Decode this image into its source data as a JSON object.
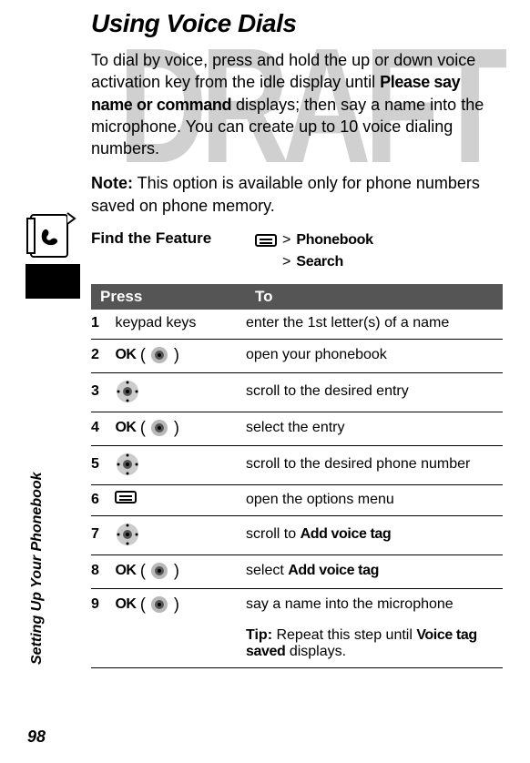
{
  "watermark": "DRAFT",
  "title": "Using Voice Dials",
  "intro": {
    "before": "To dial by voice, press and hold the up or down voice activation key from the idle display until ",
    "emph": "Please say name or command",
    "after": " displays; then say a name into the microphone. You can create up to 10 voice dialing numbers."
  },
  "note": {
    "label": "Note:",
    "text": " This option is available only for phone numbers saved on phone memory."
  },
  "feature": {
    "label": "Find the Feature",
    "nav1": "Phonebook",
    "nav2": "Search"
  },
  "table": {
    "h1": "Press",
    "h2": "To",
    "rows": [
      {
        "n": "1",
        "press_type": "text",
        "press": "keypad keys",
        "to": "enter the 1st letter(s) of a name"
      },
      {
        "n": "2",
        "press_type": "ok",
        "ok": "OK",
        "to": "open your phonebook"
      },
      {
        "n": "3",
        "press_type": "nav",
        "to": "scroll to the desired entry"
      },
      {
        "n": "4",
        "press_type": "ok",
        "ok": "OK",
        "to": "select the entry"
      },
      {
        "n": "5",
        "press_type": "nav",
        "to": "scroll to the desired phone number"
      },
      {
        "n": "6",
        "press_type": "menu",
        "to": "open the options menu"
      },
      {
        "n": "7",
        "press_type": "nav",
        "to_before": "scroll to ",
        "to_emph": "Add voice tag"
      },
      {
        "n": "8",
        "press_type": "ok",
        "ok": "OK",
        "to_before": "select ",
        "to_emph": "Add voice tag"
      },
      {
        "n": "9",
        "press_type": "ok",
        "ok": "OK",
        "to": "say a name into the microphone"
      }
    ],
    "tip": {
      "label": "Tip:",
      "before": " Repeat this step until ",
      "emph": "Voice tag saved",
      "after": " displays."
    }
  },
  "side_label": "Setting Up Your Phonebook",
  "page_number": "98"
}
